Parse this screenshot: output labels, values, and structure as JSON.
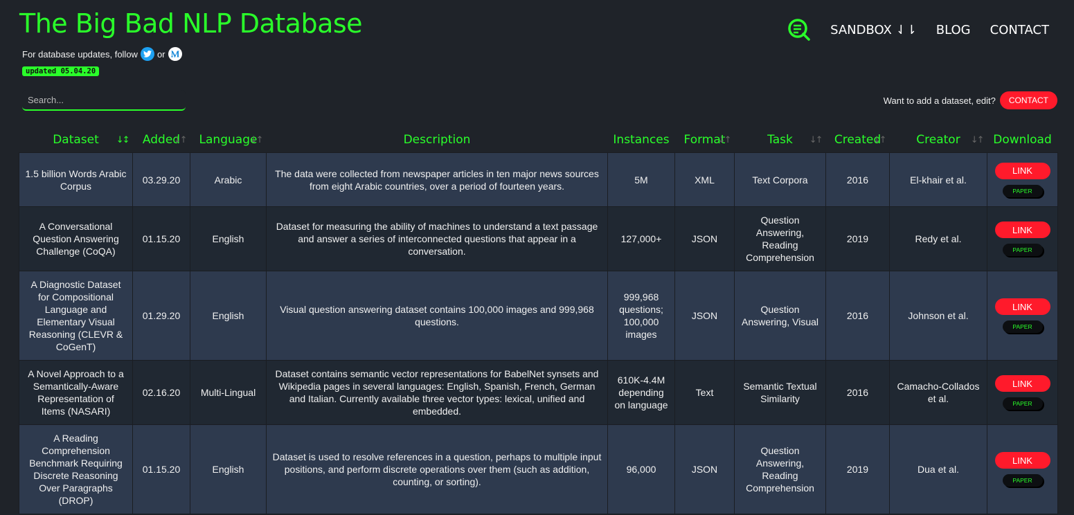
{
  "header": {
    "title": "The Big Bad NLP Database",
    "follow_text": "For database updates, follow",
    "follow_or": "or",
    "updated": "updated 05.04.20"
  },
  "nav": {
    "items": [
      "SANDBOX ⇃⇂",
      "BLOG",
      "CONTACT"
    ]
  },
  "search": {
    "placeholder": "Search..."
  },
  "add": {
    "text": "Want to add a dataset, edit?",
    "button": "CONTACT"
  },
  "table": {
    "headers": [
      "Dataset",
      "Added",
      "Language",
      "Description",
      "Instances",
      "Format",
      "Task",
      "Created",
      "Creator",
      "Download"
    ],
    "link_label": "LINK",
    "paper_label": "PAPER",
    "rows": [
      {
        "dataset": "1.5 billion Words Arabic Corpus",
        "added": "03.29.20",
        "language": "Arabic",
        "description": "The data were collected from newspaper articles in ten major news sources from eight Arabic countries, over a period of fourteen years.",
        "instances": "5M",
        "format": "XML",
        "task": "Text Corpora",
        "created": "2016",
        "creator": "El-khair et al."
      },
      {
        "dataset": "A Conversational Question Answering Challenge (CoQA)",
        "added": "01.15.20",
        "language": "English",
        "description": "Dataset for measuring the ability of machines to understand a text passage and answer a series of interconnected questions that appear in a conversation.",
        "instances": "127,000+",
        "format": "JSON",
        "task": "Question Answering, Reading Comprehension",
        "created": "2019",
        "creator": "Redy et al."
      },
      {
        "dataset": "A Diagnostic Dataset for Compositional Language and Elementary Visual Reasoning (CLEVR & CoGenT)",
        "added": "01.29.20",
        "language": "English",
        "description": "Visual question answering dataset contains 100,000 images and 999,968 questions.",
        "instances": "999,968 questions; 100,000 images",
        "format": "JSON",
        "task": "Question Answering, Visual",
        "created": "2016",
        "creator": "Johnson et al."
      },
      {
        "dataset": "A Novel Approach to a Semantically-Aware Representation of Items (NASARI)",
        "added": "02.16.20",
        "language": "Multi-Lingual",
        "description": "Dataset contains semantic vector representations for BabelNet synsets and Wikipedia pages in several languages: English, Spanish, French, German and Italian. Currently available three vector types: lexical, unified and embedded.",
        "instances": "610K-4.4M depending on language",
        "format": "Text",
        "task": "Semantic Textual Similarity",
        "created": "2016",
        "creator": "Camacho-Collados et al."
      },
      {
        "dataset": "A Reading Comprehension Benchmark Requiring Discrete Reasoning Over Paragraphs (DROP)",
        "added": "01.15.20",
        "language": "English",
        "description": "Dataset is used to resolve references in a question, perhaps to multiple input positions, and perform discrete operations over them (such as addition, counting, or sorting).",
        "instances": "96,000",
        "format": "JSON",
        "task": "Question Answering, Reading Comprehension",
        "created": "2019",
        "creator": "Dua et al."
      }
    ]
  },
  "colors": {
    "accent": "#2aff2a",
    "button": "#ff1a2b",
    "background": "#1f2329"
  }
}
